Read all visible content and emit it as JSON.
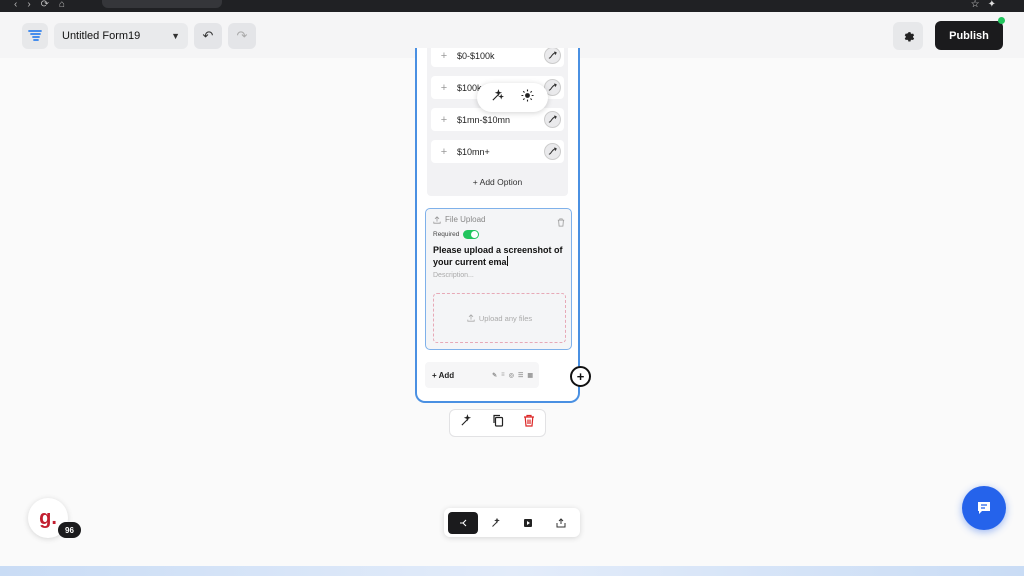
{
  "header": {
    "form_title": "Untitled Form19",
    "publish_label": "Publish"
  },
  "options": [
    {
      "label": "$0-$100k"
    },
    {
      "label": "$100k-$1mn"
    },
    {
      "label": "$1mn-$10mn"
    },
    {
      "label": "$10mn+"
    }
  ],
  "add_option_label": "+ Add Option",
  "upload_block": {
    "type_label": "File Upload",
    "required_label": "Required",
    "question": "Please upload a screenshot of your current ema",
    "description_placeholder": "Description...",
    "dropzone_label": "Upload any files"
  },
  "add_bar": {
    "label": "+ Add"
  },
  "avatar": {
    "letter": "g.",
    "badge": "96"
  },
  "colors": {
    "accent_blue": "#4a90e2",
    "publish_bg": "#1b1b1d",
    "toggle_on": "#22c55e",
    "delete_red": "#dc2626",
    "chat_blue": "#2563eb"
  }
}
